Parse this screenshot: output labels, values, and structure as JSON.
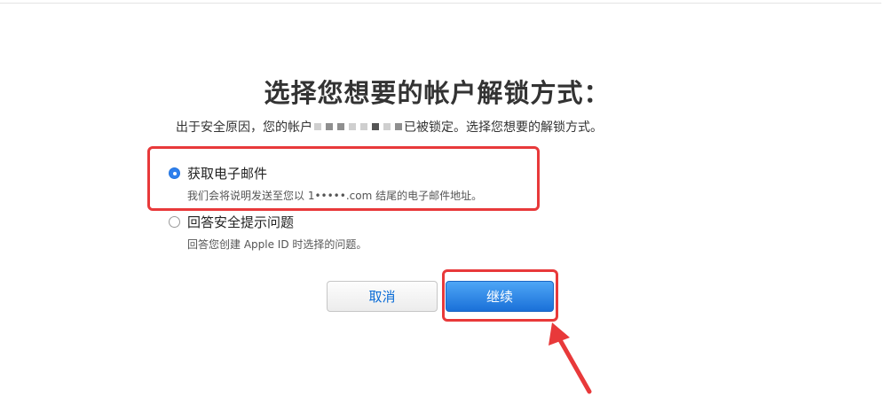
{
  "header": {
    "title": "选择您想要的帐户解锁方式："
  },
  "notice": {
    "prefix": "出于安全原因，您的帐户",
    "suffix": "已被锁定。选择您想要的解锁方式。"
  },
  "options": [
    {
      "label": "获取电子邮件",
      "description": "我们会将说明发送至您以 1•••••.com 结尾的电子邮件地址。",
      "selected": true
    },
    {
      "label": "回答安全提示问题",
      "description": "回答您创建 Apple ID 时选择的问题。",
      "selected": false
    }
  ],
  "buttons": {
    "cancel_label": "取消",
    "continue_label": "继续"
  },
  "colors": {
    "accent": "#2f80ed",
    "annotation": "#e8393a"
  }
}
